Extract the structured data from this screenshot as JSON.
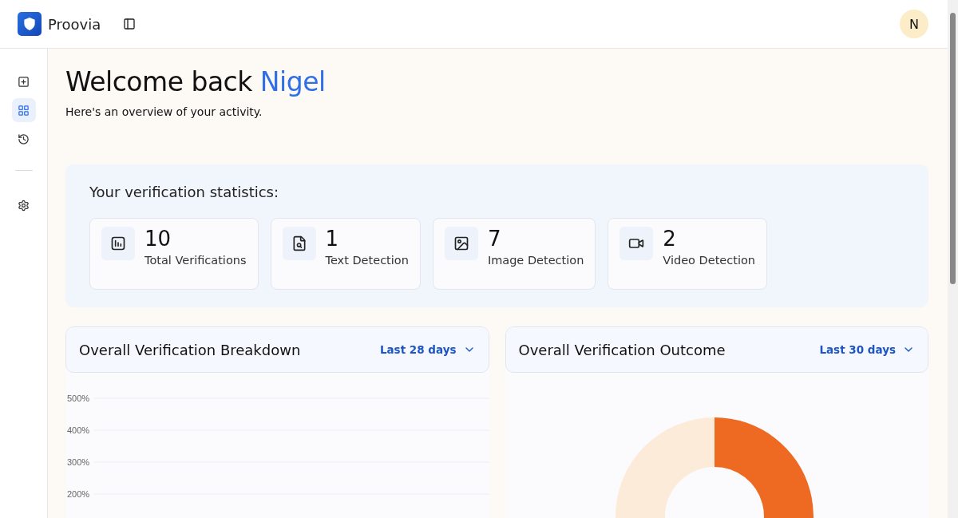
{
  "header": {
    "brand": "Proovia",
    "avatar": "N"
  },
  "sidebar": {
    "items": [
      {
        "kind": "new",
        "selected": false
      },
      {
        "kind": "dashboard",
        "selected": true
      },
      {
        "kind": "history",
        "selected": false
      },
      {
        "kind": "settings",
        "selected": false
      }
    ]
  },
  "welcome": {
    "title": "Welcome back **Nigel**",
    "subtitle": "Here's an overview of your activity."
  },
  "stats": {
    "title": "Your verification statistics:",
    "items": [
      {
        "kind": "total",
        "value": "10",
        "label": "Total Verifications"
      },
      {
        "kind": "text",
        "value": "1",
        "label": "Text Detection"
      },
      {
        "kind": "image",
        "value": "7",
        "label": "Image Detection"
      },
      {
        "kind": "video",
        "value": "2",
        "label": "Video Detection"
      }
    ]
  },
  "charts": [
    {
      "kind": "line",
      "title": "Overall Verification Breakdown",
      "period": "Last 28 days",
      "y_labels": [
        "500%",
        "400%",
        "300%",
        "200%"
      ]
    },
    {
      "kind": "donut",
      "title": "Overall Verification Outcome",
      "period": "Last 30 days"
    }
  ]
}
